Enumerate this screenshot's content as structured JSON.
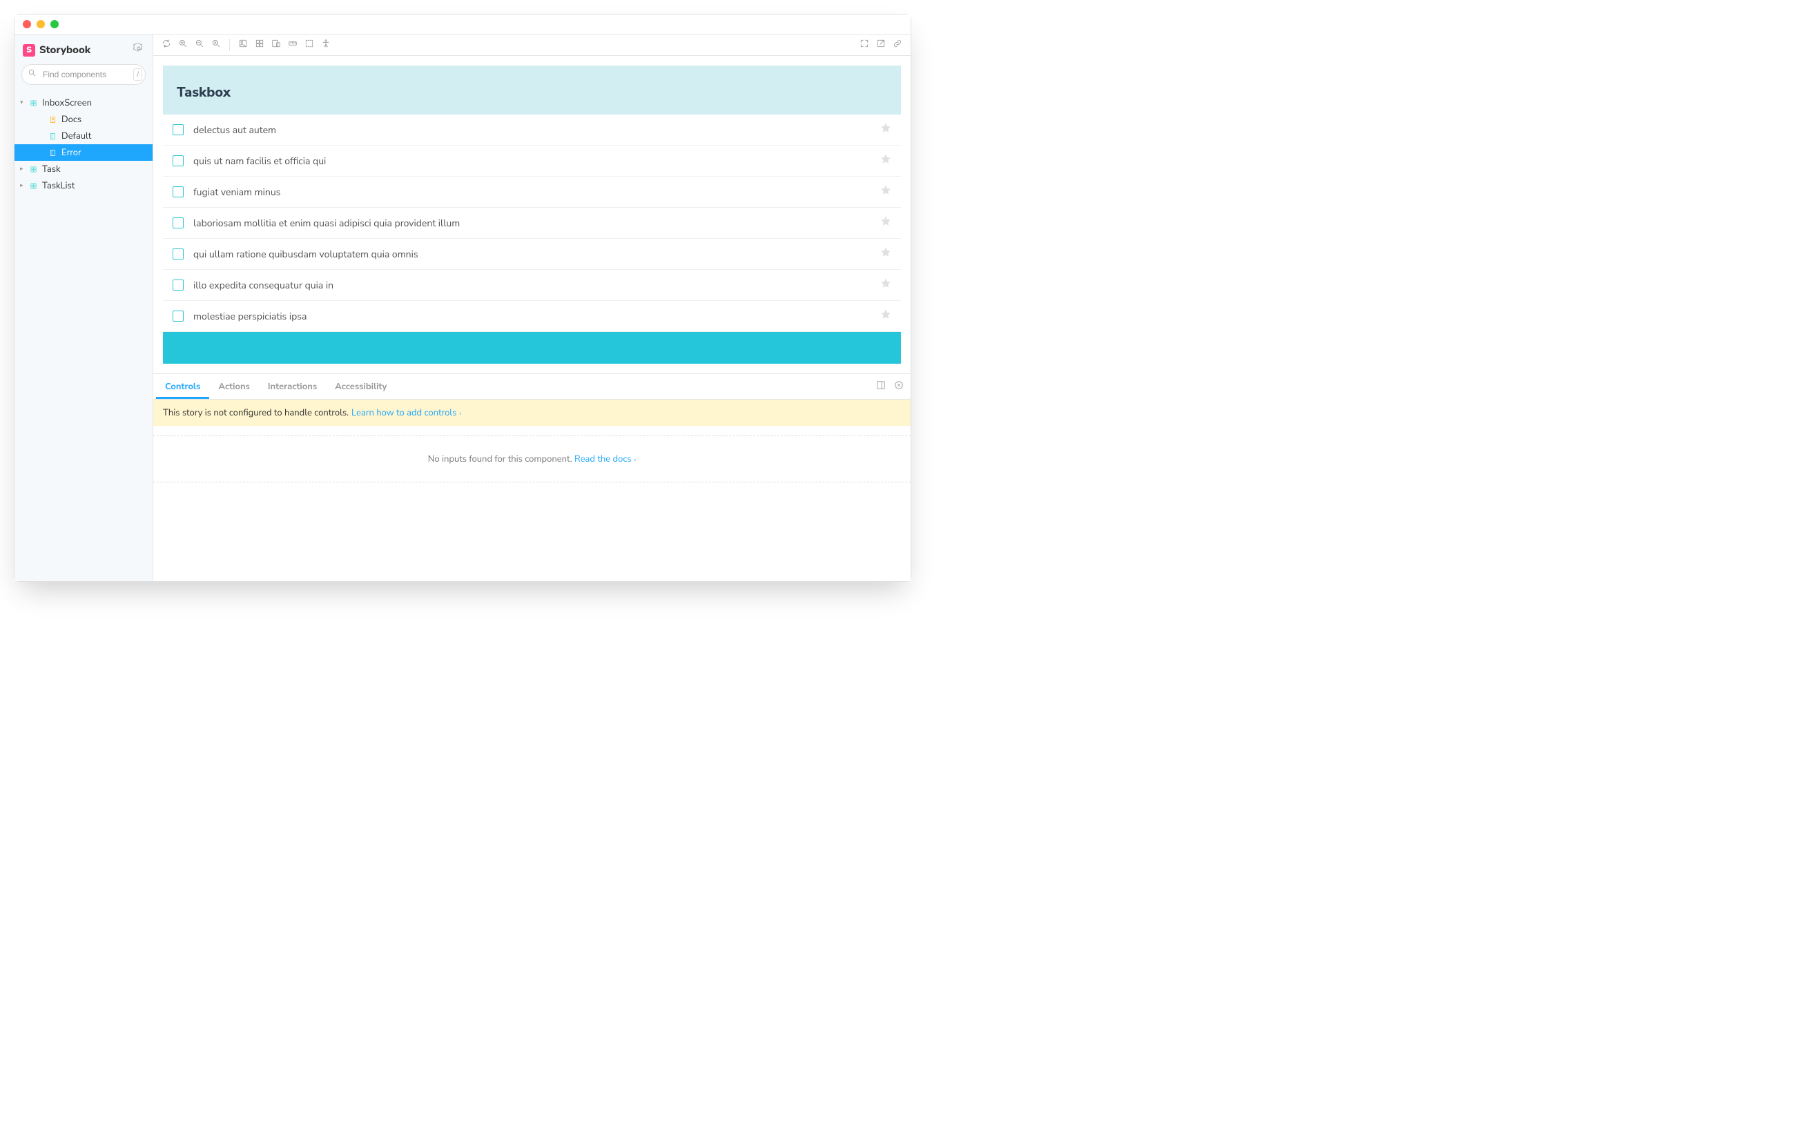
{
  "brand": {
    "name": "Storybook",
    "logo_letter": "S"
  },
  "search": {
    "placeholder": "Find components",
    "shortcut": "/"
  },
  "sidebar": {
    "items": [
      {
        "label": "InboxScreen",
        "type": "component",
        "depth": 0,
        "expanded": true,
        "selected": false
      },
      {
        "label": "Docs",
        "type": "docs",
        "depth": 1,
        "expanded": false,
        "selected": false
      },
      {
        "label": "Default",
        "type": "story",
        "depth": 1,
        "expanded": false,
        "selected": false
      },
      {
        "label": "Error",
        "type": "story",
        "depth": 1,
        "expanded": false,
        "selected": true
      },
      {
        "label": "Task",
        "type": "component",
        "depth": 0,
        "expanded": false,
        "selected": false
      },
      {
        "label": "TaskList",
        "type": "component",
        "depth": 0,
        "expanded": false,
        "selected": false
      }
    ]
  },
  "toolbar": {
    "left_group_a": [
      "sync-icon",
      "zoom-in-icon",
      "zoom-out-icon",
      "zoom-reset-icon"
    ],
    "left_group_b": [
      "background-icon",
      "grid-icon",
      "viewport-icon",
      "measure-icon",
      "outline-icon",
      "accessibility-vision-icon"
    ],
    "right_group": [
      "fullscreen-icon",
      "open-new-tab-icon",
      "copy-link-icon"
    ]
  },
  "preview": {
    "app_title": "Taskbox",
    "tasks": [
      "delectus aut autem",
      "quis ut nam facilis et officia qui",
      "fugiat veniam minus",
      "laboriosam mollitia et enim quasi adipisci quia provident illum",
      "qui ullam ratione quibusdam voluptatem quia omnis",
      "illo expedita consequatur quia in",
      "molestiae perspiciatis ipsa"
    ]
  },
  "addons": {
    "tabs": [
      "Controls",
      "Actions",
      "Interactions",
      "Accessibility"
    ],
    "active_tab": "Controls",
    "warning_prefix": "This story is not configured to handle controls. ",
    "warning_link": "Learn how to add controls",
    "empty_prefix": "No inputs found for this component. ",
    "empty_link": "Read the docs"
  }
}
